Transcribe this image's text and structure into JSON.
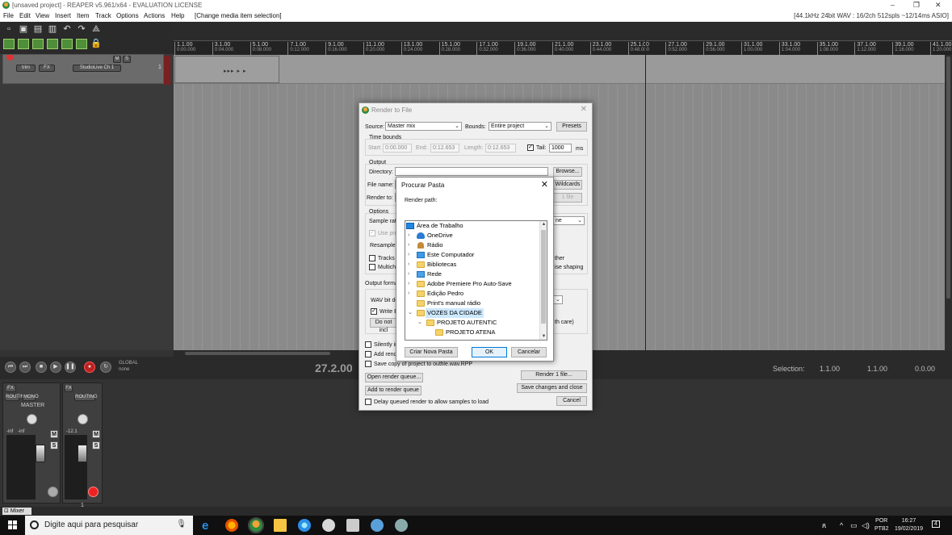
{
  "window": {
    "title": "[unsaved project] - REAPER v5.961/x64 - EVALUATION LICENSE",
    "minimize": "–",
    "restore": "❐",
    "close": "✕"
  },
  "menu": {
    "items": [
      "File",
      "Edit",
      "View",
      "Insert",
      "Item",
      "Track",
      "Options",
      "Actions",
      "Help",
      "[Change media item selection]"
    ],
    "info": "[44.1kHz 24bit WAV : 16/2ch 512spls ~12/14ms ASIO]"
  },
  "ruler": {
    "marks": [
      {
        "bar": "1.1.00",
        "time": "0:00.000"
      },
      {
        "bar": "3.1.00",
        "time": "0:04.000"
      },
      {
        "bar": "5.1.00",
        "time": "0:08.000"
      },
      {
        "bar": "7.1.00",
        "time": "0:12.000"
      },
      {
        "bar": "9.1.00",
        "time": "0:16.000"
      },
      {
        "bar": "11.1.00",
        "time": "0:20.000"
      },
      {
        "bar": "13.1.00",
        "time": "0:24.000"
      },
      {
        "bar": "15.1.00",
        "time": "0:28.000"
      },
      {
        "bar": "17.1.00",
        "time": "0:32.000"
      },
      {
        "bar": "19.1.00",
        "time": "0:36.000"
      },
      {
        "bar": "21.1.00",
        "time": "0:40.000"
      },
      {
        "bar": "23.1.00",
        "time": "0:44.000"
      },
      {
        "bar": "25.1.00",
        "time": "0:48.000"
      },
      {
        "bar": "27.1.00",
        "time": "0:52.000"
      },
      {
        "bar": "29.1.00",
        "time": "0:56.000"
      },
      {
        "bar": "31.1.00",
        "time": "1:00.000"
      },
      {
        "bar": "33.1.00",
        "time": "1:04.000"
      },
      {
        "bar": "35.1.00",
        "time": "1:08.000"
      },
      {
        "bar": "37.1.00",
        "time": "1:12.000"
      },
      {
        "bar": "39.1.00",
        "time": "1:16.000"
      },
      {
        "bar": "41.1.00",
        "time": "1:20.000"
      },
      {
        "bar": "43.1.00",
        "time": "1:24.000"
      }
    ]
  },
  "track": {
    "number": "1",
    "trim_label": "trim",
    "fx_label": "FX",
    "m_label": "M",
    "s_label": "S",
    "input_label": "StudioLive Ch 1",
    "wave_glyph": "▸▸▸ ▸ ▸"
  },
  "transport": {
    "timecode": "27.2.00",
    "global_label": "GLOBAL",
    "global_sub": "none",
    "selection_label": "Selection:",
    "selection_start": "1.1.00",
    "selection_end": "1.1.00",
    "selection_length": "0.0.00"
  },
  "mixer": {
    "master_label": "MASTER",
    "routing_label": "ROUTING",
    "mono_label": "MONO",
    "fx_label": "FX",
    "master_level": "-inf",
    "master_level2": "-inf",
    "track_level": "-12.1",
    "track_number": "1",
    "m_label": "M",
    "s_label": "S",
    "tab_label": "Mixer"
  },
  "render_dialog": {
    "title": "Render to File",
    "source_label": "Source:",
    "source_value": "Master mix",
    "bounds_label": "Bounds:",
    "bounds_value": "Entire project",
    "presets_button": "Presets",
    "time_bounds_label": "Time bounds",
    "start_label": "Start:",
    "start_value": "0:00.000",
    "end_label": "End:",
    "end_value": "0:12.653",
    "length_label": "Length:",
    "length_value": "0:12.653",
    "tail_label": "Tail:",
    "tail_value": "1000",
    "tail_unit": "ms",
    "output_label": "Output",
    "directory_label": "Directory:",
    "browse_button": "Browse...",
    "filename_label": "File name:",
    "wildcards_button": "Wildcards",
    "render_to_label": "Render to:",
    "files_button": "1 file",
    "options_label": "Options",
    "sample_rate_label": "Sample rate",
    "channels_select_partial": "ne",
    "use_project_label": "Use proj",
    "resample_label": "Resample n",
    "tracks_label": "Tracks w",
    "multichannel_label": "Multicha",
    "dither_label": "ther",
    "noise_shaping_label": "ise shaping",
    "output_format_label": "Output format",
    "wav_bit_label": "WAV bit de",
    "write_bwf_label": "Write BV",
    "do_not_include_label": "Do not incl",
    "with_care_label": "th care)",
    "silently_label": "Silently inc",
    "add_render_label": "Add rende",
    "save_copy_label": "Save copy of project to outfile.wav.RPP",
    "open_queue_button": "Open render queue...",
    "render_button": "Render 1 file...",
    "add_queue_button": "Add to render queue",
    "save_close_button": "Save changes and close",
    "delay_queue_label": "Delay queued render to allow samples to load",
    "cancel_button": "Cancel"
  },
  "folder_dialog": {
    "title": "Procurar Pasta",
    "subtitle": "Render path:",
    "tree": [
      {
        "label": "Área de Trabalho",
        "icon": "desktop-icon",
        "indent": 0,
        "expander": ""
      },
      {
        "label": "OneDrive",
        "icon": "cloud-icon",
        "indent": 1,
        "expander": "›"
      },
      {
        "label": "Rádio",
        "icon": "user-icon",
        "indent": 1,
        "expander": "›"
      },
      {
        "label": "Este Computador",
        "icon": "computer-icon",
        "indent": 1,
        "expander": "›"
      },
      {
        "label": "Bibliotecas",
        "icon": "library-icon",
        "indent": 1,
        "expander": "›"
      },
      {
        "label": "Rede",
        "icon": "network-icon",
        "indent": 1,
        "expander": "›"
      },
      {
        "label": "Adobe Premiere Pro Auto-Save",
        "icon": "folder-icon",
        "indent": 1,
        "expander": "›"
      },
      {
        "label": "Edição Pedro",
        "icon": "folder-icon",
        "indent": 1,
        "expander": "›"
      },
      {
        "label": "Print's manual rádio",
        "icon": "folder-icon",
        "indent": 1,
        "expander": ""
      },
      {
        "label": "VOZES DA CIDADE",
        "icon": "folder-icon",
        "indent": 1,
        "expander": "⌄",
        "selected": true
      },
      {
        "label": "PROJETO AUTENTIC",
        "icon": "folder-icon",
        "indent": 2,
        "expander": "⌄"
      },
      {
        "label": "PROJETO ATENA",
        "icon": "folder-icon",
        "indent": 3,
        "expander": ""
      }
    ],
    "new_folder_button": "Criar Nova Pasta",
    "ok_button": "OK",
    "cancel_button": "Cancelar"
  },
  "taskbar": {
    "search_placeholder": "Digite aqui para pesquisar",
    "language": "POR",
    "layout": "PTB2",
    "time": "16:27",
    "date": "19/02/2019",
    "notifications": "4"
  }
}
